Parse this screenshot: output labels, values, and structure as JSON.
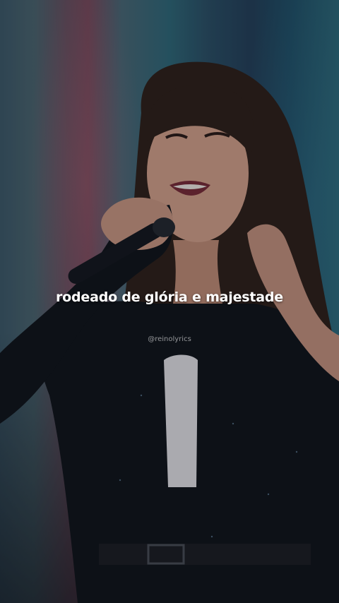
{
  "lyric": {
    "text": "rodeado de glória e majestade"
  },
  "watermark": {
    "handle": "@reinolyrics"
  },
  "scene": {
    "subject": "singer-with-microphone",
    "colors": {
      "pink_light": "#7a4a5c",
      "teal_light": "#2f6a7a",
      "jacket": "#0e1218",
      "hair": "#3a2418"
    }
  }
}
